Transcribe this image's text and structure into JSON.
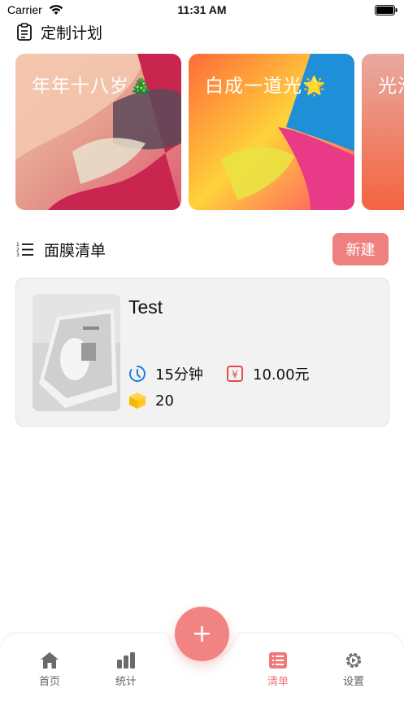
{
  "status_bar": {
    "carrier": "Carrier",
    "time": "11:31 AM"
  },
  "plan_section": {
    "title": "定制计划",
    "cards": [
      {
        "title": "年年十八岁🎄"
      },
      {
        "title": "白成一道光🌟"
      },
      {
        "title": "光滑"
      }
    ]
  },
  "list_section": {
    "title": "面膜清单",
    "new_label": "新建"
  },
  "items": [
    {
      "name": "Test",
      "duration": "15分钟",
      "price": "10.00元",
      "count": "20"
    }
  ],
  "tab_bar": {
    "add_label": "+",
    "tabs": [
      {
        "label": "首页",
        "icon": "home-icon"
      },
      {
        "label": "统计",
        "icon": "chart-icon"
      },
      {
        "label": "清单",
        "icon": "list-icon",
        "active": true
      },
      {
        "label": "设置",
        "icon": "gear-icon"
      }
    ]
  },
  "colors": {
    "accent": "#f08080",
    "card_bg": "#f2f2f2",
    "active_tab": "#f07a7a"
  }
}
